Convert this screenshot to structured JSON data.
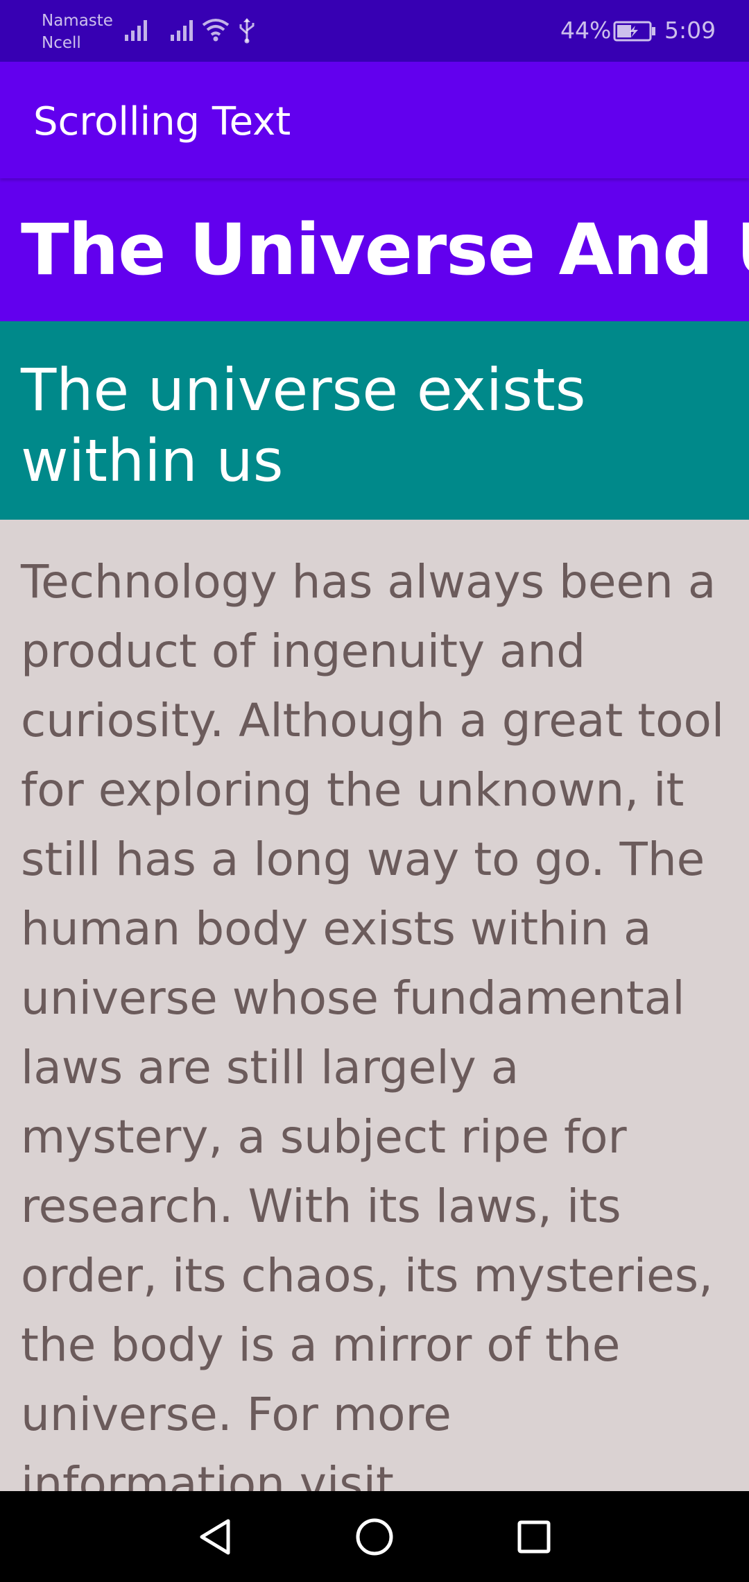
{
  "status_bar": {
    "carrier_line1": "Namaste",
    "carrier_line2": "Ncell",
    "battery_percent": "44%",
    "time": "5:09",
    "icons": [
      "signal-icon",
      "signal-icon",
      "wifi-icon",
      "usb-icon",
      "battery-charging-icon"
    ]
  },
  "app_bar": {
    "title": "Scrolling Text"
  },
  "content": {
    "heading": "The Universe And Us",
    "subheading": "The universe exists within us",
    "article": "Technology has always been a product of ingenuity and curiosity. Although a great tool for exploring the unknown, it still has a long way to go. The human body exists within a universe whose fundamental laws are still largely a mystery, a subject ripe for research. With its laws, its order, its chaos, its mysteries, the body is a mirror of the universe. For more information visit www.scoote.com. Throughout"
  },
  "nav_bar": {
    "icons": [
      "back-icon",
      "home-icon",
      "recents-icon"
    ]
  },
  "colors": {
    "status_bar": "#3700B3",
    "primary": "#6200EE",
    "teal": "#00898A",
    "article_background": "#DAD2D2",
    "article_text": "#6B5B5B"
  }
}
